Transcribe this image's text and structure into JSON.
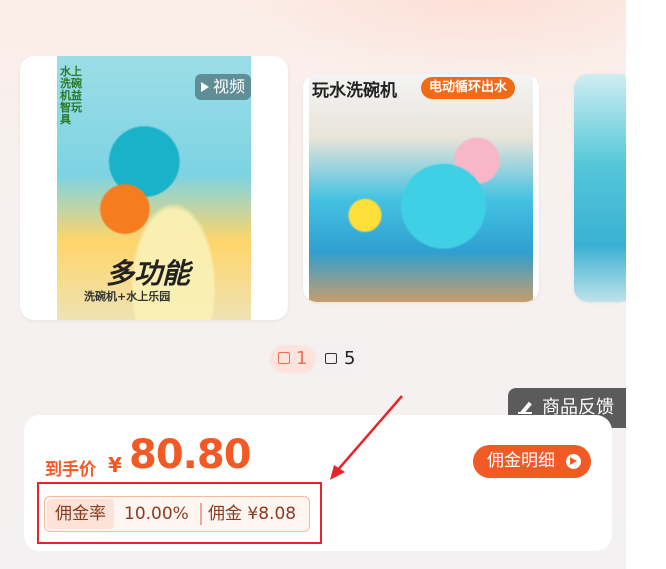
{
  "gallery": {
    "cards": [
      {
        "video_badge": "视频",
        "overlay_small": "水上洗碗机益智玩具",
        "overlay_big": "多功能",
        "overlay_sub": "洗碗机+水上乐园"
      },
      {
        "title": "玩水洗碗机",
        "badge": "电动循环出水"
      },
      {}
    ],
    "pager": {
      "video_count": "1",
      "image_count": "5"
    }
  },
  "feedback": {
    "label": "商品反馈"
  },
  "price": {
    "prefix": "到手价",
    "currency": "¥",
    "value": "80.80"
  },
  "commission": {
    "detail_button": "佣金明细",
    "rate_label": "佣金率",
    "rate_value": "10.00%",
    "amount": "佣金 ¥8.08"
  },
  "colors": {
    "accent": "#f15a24",
    "annotation": "#e8242a"
  }
}
